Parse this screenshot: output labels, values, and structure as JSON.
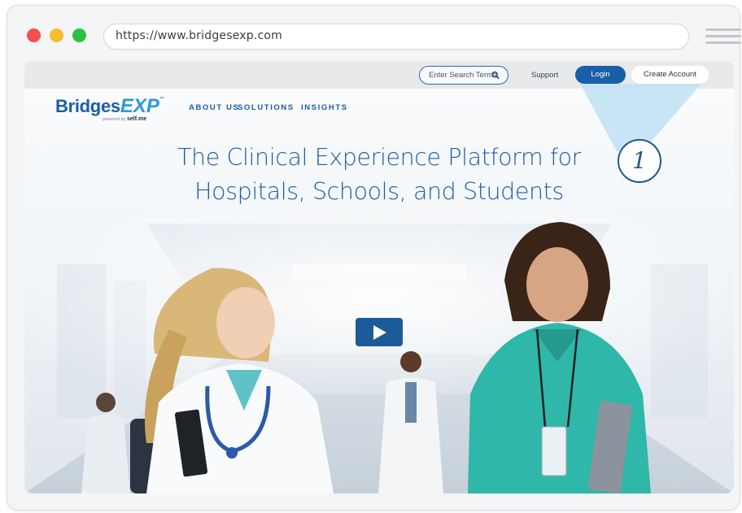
{
  "browser": {
    "url": "https://www.bridgesexp.com"
  },
  "topbar": {
    "search_placeholder": "Enter Search Terms",
    "support_label": "Support",
    "login_label": "Login",
    "create_account_label": "Create Account"
  },
  "logo": {
    "word1": "Bridges",
    "word2": "EXP",
    "trademark": "™",
    "powered_by": "powered by",
    "powered_brand": "self.me"
  },
  "nav": {
    "items": [
      "ABOUT US",
      "SOLUTIONS",
      "INSIGHTS"
    ]
  },
  "hero": {
    "title_line1": "The Clinical Experience Platform for",
    "title_line2": "Hospitals, Schools, and Students"
  },
  "callout": {
    "number": "1"
  },
  "colors": {
    "brand_blue": "#1a5ea8",
    "brand_light_blue": "#2b9ad8",
    "teal_scrubs": "#2fb7a9",
    "callout_beam": "#bfe0f5"
  },
  "icons": {
    "search": "magnifier-icon",
    "play": "play-icon",
    "menu": "hamburger-icon"
  }
}
